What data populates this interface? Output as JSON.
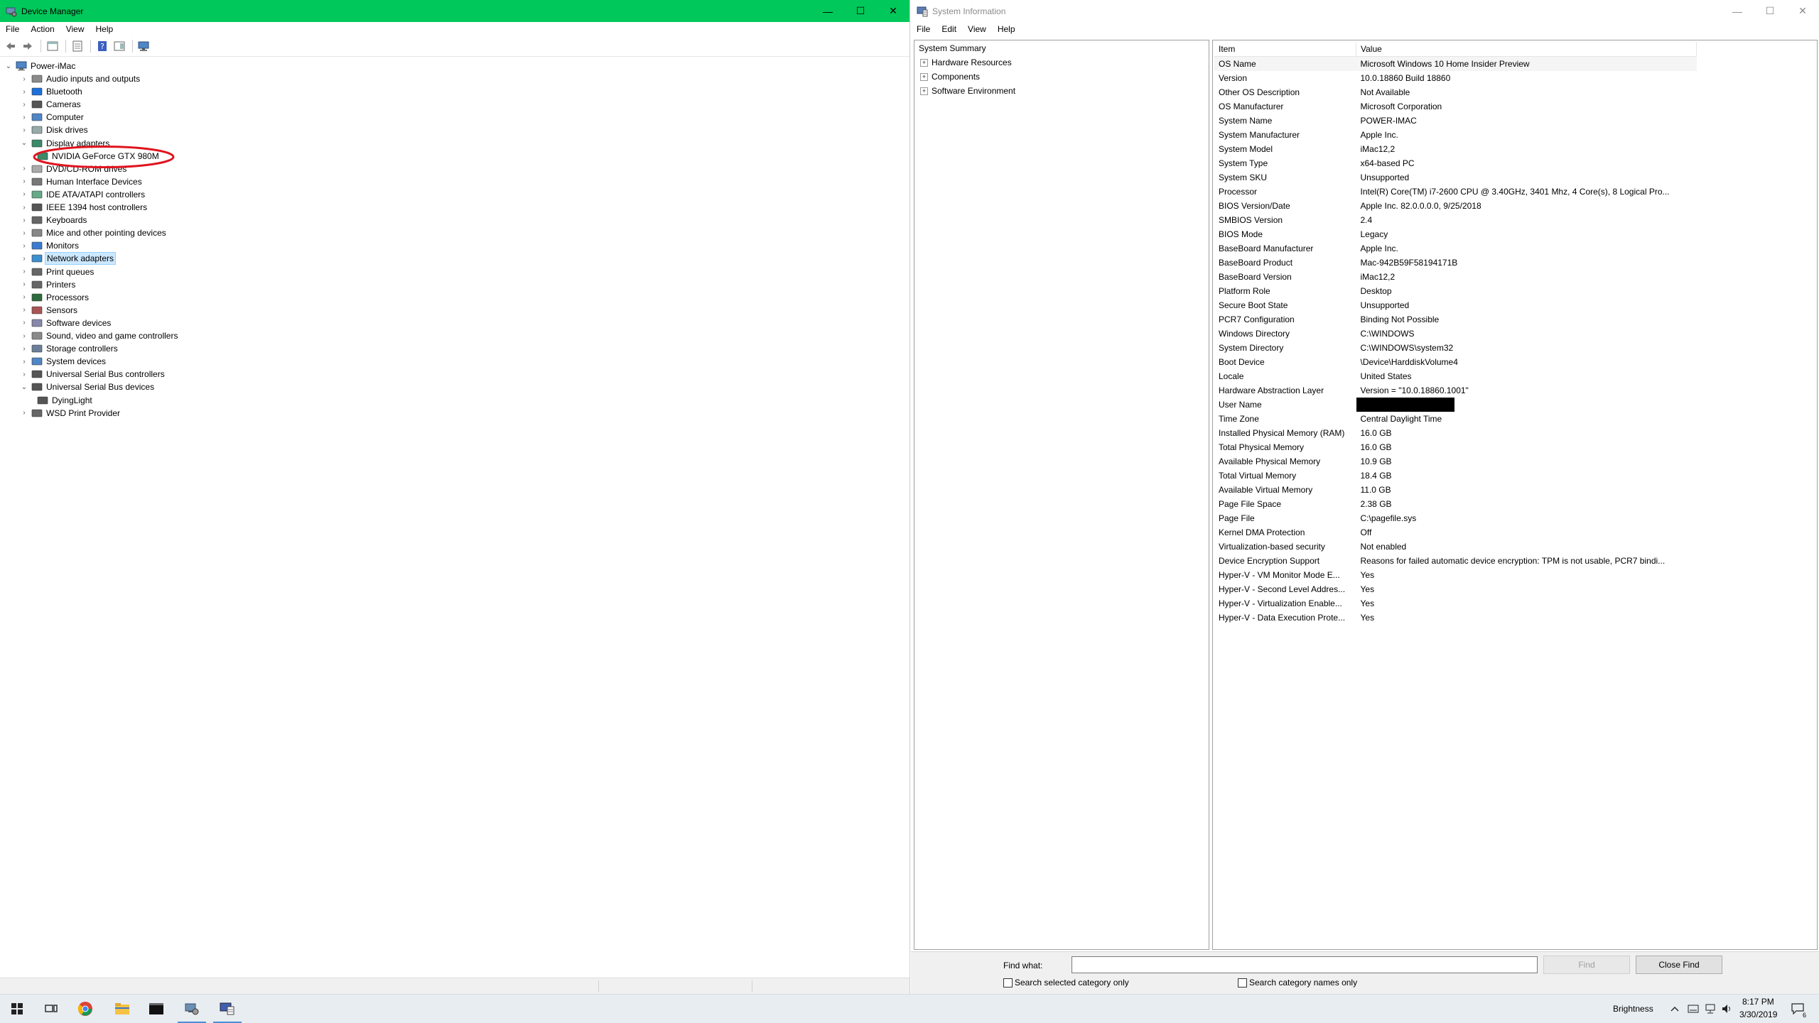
{
  "colors": {
    "dm_titlebar": "#00c85a",
    "selection": "#cce8ff",
    "annotation": "#e0141e"
  },
  "device_manager": {
    "title": "Device Manager",
    "caption": {
      "minimize": "—",
      "maximize": "☐",
      "close": "✕"
    },
    "menu": [
      "File",
      "Action",
      "View",
      "Help"
    ],
    "root": "Power-iMac",
    "categories": [
      {
        "label": "Audio inputs and outputs",
        "state": "collapsed",
        "icon": "speaker-icon"
      },
      {
        "label": "Bluetooth",
        "state": "collapsed",
        "icon": "bluetooth-icon"
      },
      {
        "label": "Cameras",
        "state": "collapsed",
        "icon": "camera-icon"
      },
      {
        "label": "Computer",
        "state": "collapsed",
        "icon": "computer-icon"
      },
      {
        "label": "Disk drives",
        "state": "collapsed",
        "icon": "disk-icon"
      },
      {
        "label": "Display adapters",
        "state": "expanded",
        "icon": "display-adapter-icon"
      },
      {
        "label": "NVIDIA GeForce GTX 980M",
        "state": "child",
        "icon": "display-adapter-icon"
      },
      {
        "label": "DVD/CD-ROM drives",
        "state": "collapsed",
        "icon": "dvd-icon"
      },
      {
        "label": "Human Interface Devices",
        "state": "collapsed",
        "icon": "hid-icon"
      },
      {
        "label": "IDE ATA/ATAPI controllers",
        "state": "collapsed",
        "icon": "ide-icon"
      },
      {
        "label": "IEEE 1394 host controllers",
        "state": "collapsed",
        "icon": "ieee1394-icon"
      },
      {
        "label": "Keyboards",
        "state": "collapsed",
        "icon": "keyboard-icon"
      },
      {
        "label": "Mice and other pointing devices",
        "state": "collapsed",
        "icon": "mouse-icon"
      },
      {
        "label": "Monitors",
        "state": "collapsed",
        "icon": "monitor-icon"
      },
      {
        "label": "Network adapters",
        "state": "selected",
        "icon": "network-icon"
      },
      {
        "label": "Print queues",
        "state": "collapsed",
        "icon": "printer-icon"
      },
      {
        "label": "Printers",
        "state": "collapsed",
        "icon": "printer-icon"
      },
      {
        "label": "Processors",
        "state": "collapsed",
        "icon": "processor-icon"
      },
      {
        "label": "Sensors",
        "state": "collapsed",
        "icon": "sensor-icon"
      },
      {
        "label": "Software devices",
        "state": "collapsed",
        "icon": "software-icon"
      },
      {
        "label": "Sound, video and game controllers",
        "state": "collapsed",
        "icon": "speaker-icon"
      },
      {
        "label": "Storage controllers",
        "state": "collapsed",
        "icon": "storage-icon"
      },
      {
        "label": "System devices",
        "state": "collapsed",
        "icon": "system-icon"
      },
      {
        "label": "Universal Serial Bus controllers",
        "state": "collapsed",
        "icon": "usb-icon"
      },
      {
        "label": "Universal Serial Bus devices",
        "state": "expanded",
        "icon": "usb-icon"
      },
      {
        "label": "DyingLight",
        "state": "child",
        "icon": "usb-icon"
      },
      {
        "label": "WSD Print Provider",
        "state": "collapsed",
        "icon": "printer-icon"
      }
    ]
  },
  "system_info": {
    "title": "System Information",
    "caption": {
      "minimize": "—",
      "maximize": "☐",
      "close": "✕"
    },
    "menu": [
      "File",
      "Edit",
      "View",
      "Help"
    ],
    "tree": [
      {
        "label": "System Summary",
        "has_children": false
      },
      {
        "label": "Hardware Resources",
        "has_children": true
      },
      {
        "label": "Components",
        "has_children": true
      },
      {
        "label": "Software Environment",
        "has_children": true
      }
    ],
    "columns": [
      "Item",
      "Value"
    ],
    "rows": [
      [
        "OS Name",
        "Microsoft Windows 10 Home Insider Preview"
      ],
      [
        "Version",
        "10.0.18860 Build 18860"
      ],
      [
        "Other OS Description",
        "Not Available"
      ],
      [
        "OS Manufacturer",
        "Microsoft Corporation"
      ],
      [
        "System Name",
        "POWER-IMAC"
      ],
      [
        "System Manufacturer",
        "Apple Inc."
      ],
      [
        "System Model",
        "iMac12,2"
      ],
      [
        "System Type",
        "x64-based PC"
      ],
      [
        "System SKU",
        "Unsupported"
      ],
      [
        "Processor",
        "Intel(R) Core(TM) i7-2600 CPU @ 3.40GHz, 3401 Mhz, 4 Core(s), 8 Logical Pro..."
      ],
      [
        "BIOS Version/Date",
        "Apple Inc. 82.0.0.0.0, 9/25/2018"
      ],
      [
        "SMBIOS Version",
        "2.4"
      ],
      [
        "BIOS Mode",
        "Legacy"
      ],
      [
        "BaseBoard Manufacturer",
        "Apple Inc."
      ],
      [
        "BaseBoard Product",
        "Mac-942B59F58194171B"
      ],
      [
        "BaseBoard Version",
        "iMac12,2"
      ],
      [
        "Platform Role",
        "Desktop"
      ],
      [
        "Secure Boot State",
        "Unsupported"
      ],
      [
        "PCR7 Configuration",
        "Binding Not Possible"
      ],
      [
        "Windows Directory",
        "C:\\WINDOWS"
      ],
      [
        "System Directory",
        "C:\\WINDOWS\\system32"
      ],
      [
        "Boot Device",
        "\\Device\\HarddiskVolume4"
      ],
      [
        "Locale",
        "United States"
      ],
      [
        "Hardware Abstraction Layer",
        "Version = \"10.0.18860.1001\""
      ],
      [
        "User Name",
        ""
      ],
      [
        "Time Zone",
        "Central Daylight Time"
      ],
      [
        "Installed Physical Memory (RAM)",
        "16.0 GB"
      ],
      [
        "Total Physical Memory",
        "16.0 GB"
      ],
      [
        "Available Physical Memory",
        "10.9 GB"
      ],
      [
        "Total Virtual Memory",
        "18.4 GB"
      ],
      [
        "Available Virtual Memory",
        "11.0 GB"
      ],
      [
        "Page File Space",
        "2.38 GB"
      ],
      [
        "Page File",
        "C:\\pagefile.sys"
      ],
      [
        "Kernel DMA Protection",
        "Off"
      ],
      [
        "Virtualization-based security",
        "Not enabled"
      ],
      [
        "Device Encryption Support",
        "Reasons for failed automatic device encryption: TPM is not usable, PCR7 bindi..."
      ],
      [
        "Hyper-V - VM Monitor Mode E...",
        "Yes"
      ],
      [
        "Hyper-V - Second Level Addres...",
        "Yes"
      ],
      [
        "Hyper-V - Virtualization Enable...",
        "Yes"
      ],
      [
        "Hyper-V - Data Execution Prote...",
        "Yes"
      ]
    ],
    "find": {
      "label": "Find what:",
      "value": "",
      "find_button": "Find",
      "close_button": "Close Find",
      "check_selected": "Search selected category only",
      "check_names": "Search category names only"
    }
  },
  "taskbar": {
    "apps": [
      "start-icon",
      "task-view-icon",
      "chrome-icon",
      "file-explorer-icon",
      "terminal-icon",
      "device-manager-icon",
      "system-information-icon"
    ],
    "brightness_label": "Brightness",
    "time": "8:17 PM",
    "date": "3/30/2019",
    "notification_count": "6"
  }
}
